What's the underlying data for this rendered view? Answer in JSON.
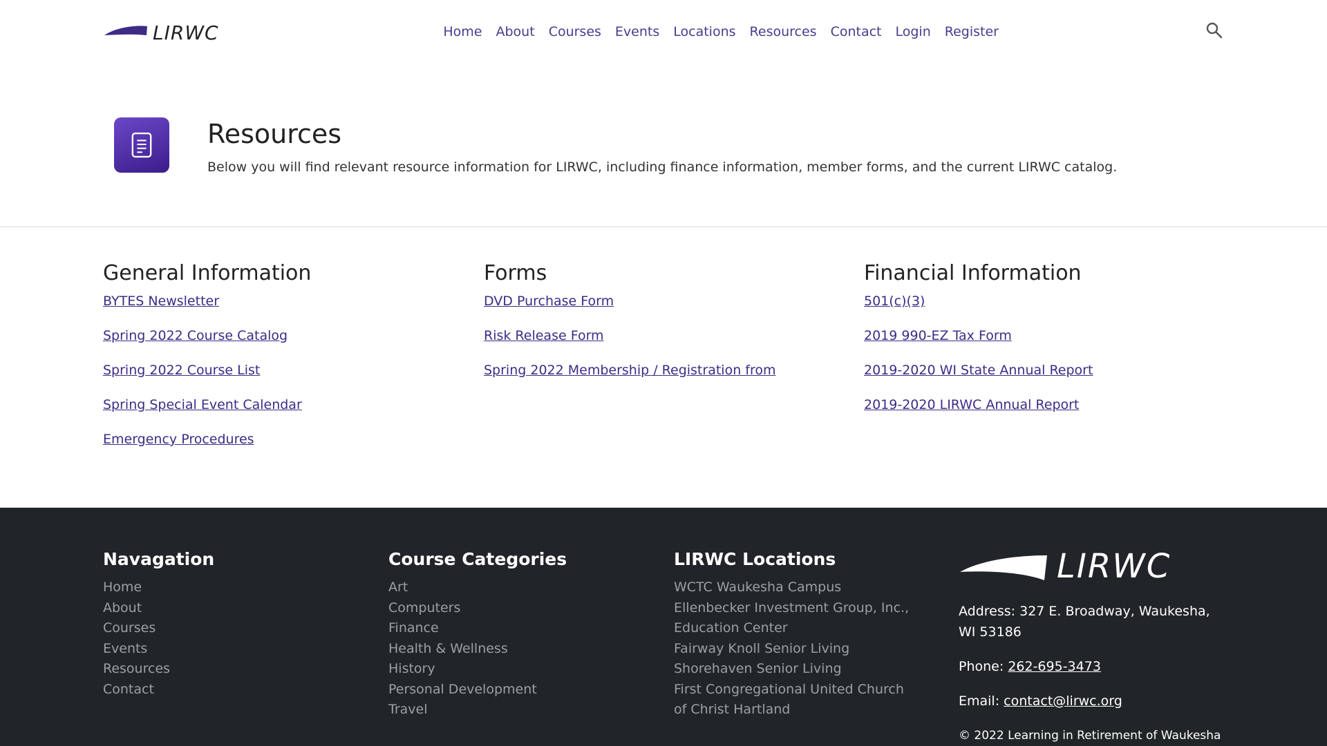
{
  "header": {
    "logo_text": "LIRWC",
    "nav": [
      "Home",
      "About",
      "Courses",
      "Events",
      "Locations",
      "Resources",
      "Contact",
      "Login",
      "Register"
    ]
  },
  "hero": {
    "title": "Resources",
    "description": "Below you will find relevant resource information for LIRWC, including finance information, member forms, and the current LIRWC catalog."
  },
  "sections": [
    {
      "title": "General Information",
      "links": [
        "BYTES Newsletter",
        "Spring 2022 Course Catalog",
        "Spring 2022 Course List",
        "Spring Special Event Calendar",
        "Emergency Procedures"
      ]
    },
    {
      "title": "Forms",
      "links": [
        "DVD Purchase Form",
        "Risk Release Form",
        "Spring 2022 Membership / Registration from"
      ]
    },
    {
      "title": "Financial Information",
      "links": [
        "501(c)(3)",
        "2019 990-EZ Tax Form",
        "2019-2020 WI State Annual Report",
        "2019-2020 LIRWC Annual Report"
      ]
    }
  ],
  "footer": {
    "nav_title": "Navagation",
    "nav_items": [
      "Home",
      "About",
      "Courses",
      "Events",
      "Resources",
      "Contact"
    ],
    "categories_title": "Course Categories",
    "categories": [
      "Art",
      "Computers",
      "Finance",
      "Health & Wellness",
      "History",
      "Personal Development",
      "Travel"
    ],
    "locations_title": "LIRWC Locations",
    "locations": [
      "WCTC Waukesha Campus",
      "Ellenbecker Investment Group, Inc., Education Center",
      "Fairway Knoll Senior Living",
      "Shorehaven Senior Living",
      "First Congregational United Church of Christ Hartland"
    ],
    "logo_text": "LIRWC",
    "address_label": "Address:",
    "address": "327 E. Broadway, Waukesha, WI 53186",
    "phone_label": "Phone:",
    "phone": "262-695-3473",
    "email_label": "Email:",
    "email": "contact@lirwc.org",
    "copyright": "© 2022 Learning in Retirement of Waukesha"
  },
  "colors": {
    "accent": "#4b3a8f",
    "icon_gradient_start": "#6b47c9",
    "icon_gradient_end": "#3b1d8a",
    "footer_bg": "#212529"
  },
  "icons": [
    "search-icon",
    "document-icon"
  ]
}
